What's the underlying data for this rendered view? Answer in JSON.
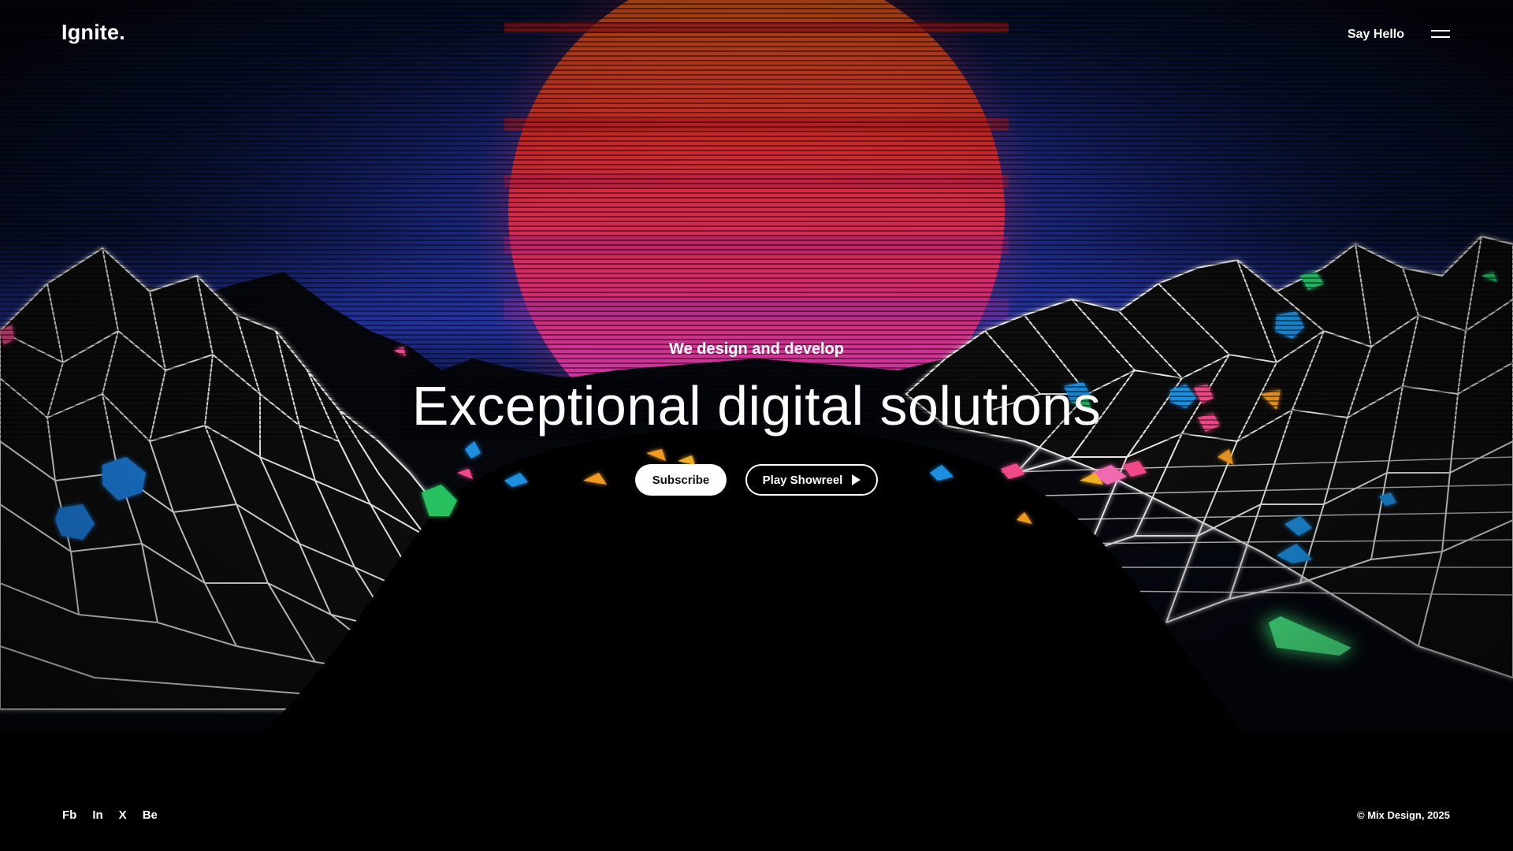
{
  "header": {
    "logo": "Ignite.",
    "say_hello": "Say Hello",
    "menu_icon": "hamburger-menu-icon"
  },
  "hero": {
    "tagline": "We design and develop",
    "headline": "Exceptional digital solutions",
    "subscribe_label": "Subscribe",
    "showreel_label": "Play Showreel",
    "showreel_icon": "play-icon"
  },
  "footer": {
    "socials": [
      "Fb",
      "In",
      "X",
      "Be"
    ],
    "copyright": "© Mix Design, 2025"
  },
  "colors": {
    "sun_top": "#e8551e",
    "sun_mid": "#d8234e",
    "sun_bottom": "#c83ad8",
    "sky_glow": "#2a3fb8",
    "wireframe": "#e8e8e8",
    "gem_blue": "#1f8fe0",
    "gem_pink": "#f04a8a",
    "gem_green": "#28d070",
    "gem_orange": "#f09a20"
  }
}
